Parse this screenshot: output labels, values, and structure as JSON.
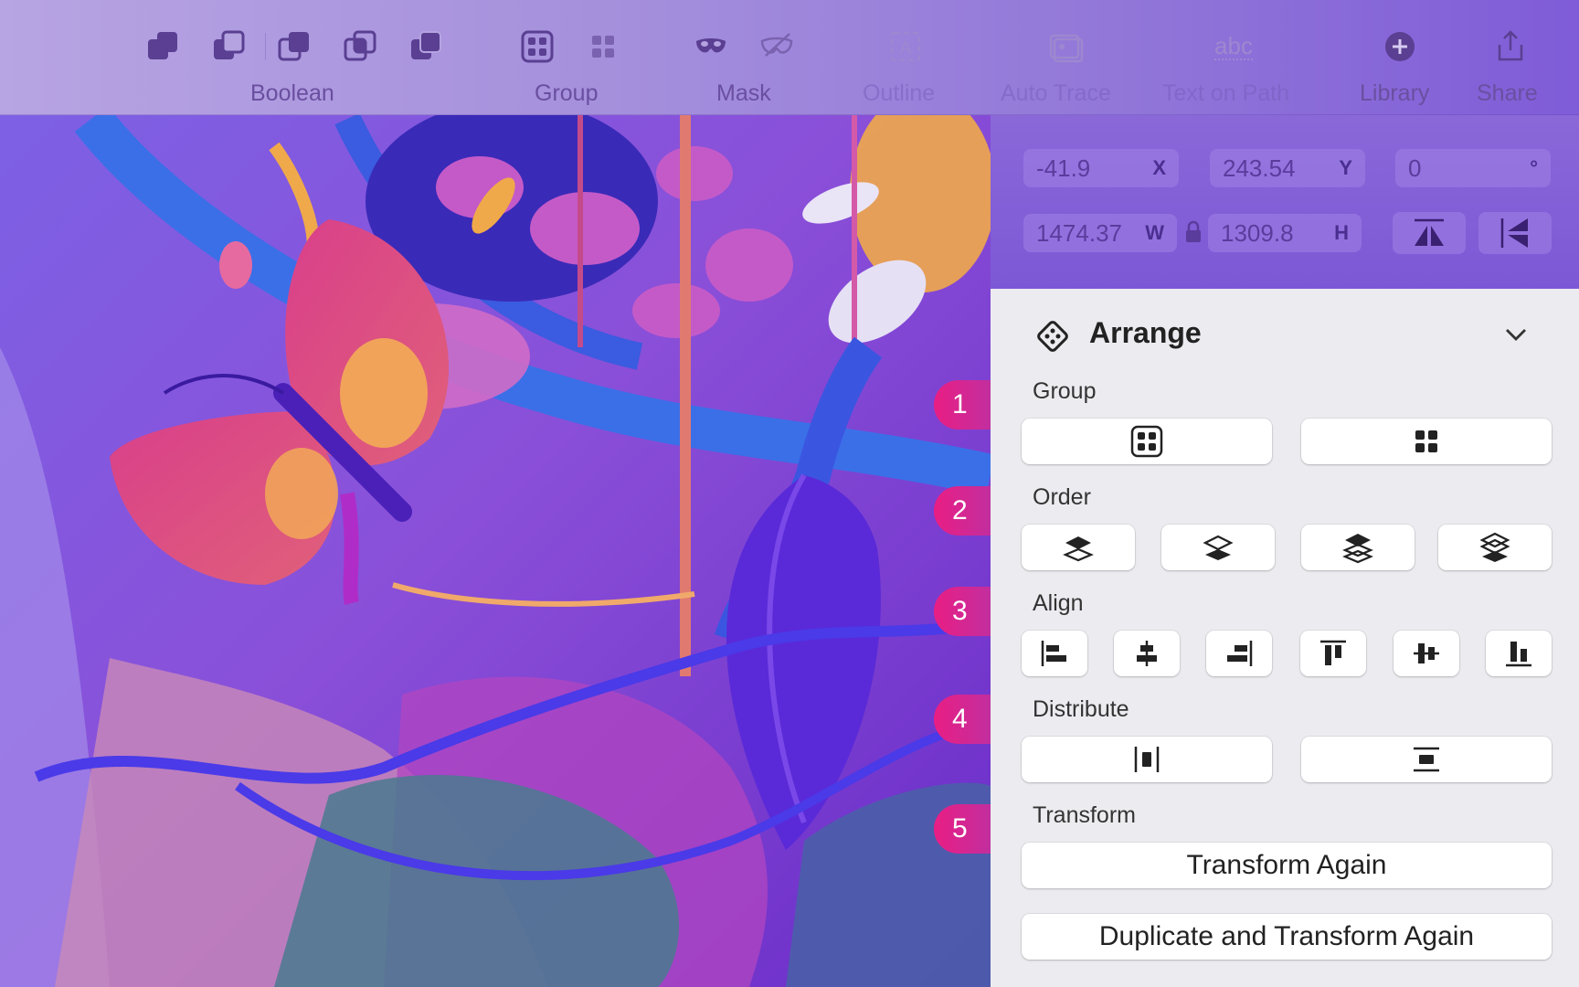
{
  "toolbar": {
    "boolean_label": "Boolean",
    "group_label": "Group",
    "mask_label": "Mask",
    "outline_label": "Outline",
    "auto_trace_label": "Auto Trace",
    "text_on_path_label": "Text on Path",
    "text_on_path_glyph": "abc",
    "library_label": "Library",
    "share_label": "Share"
  },
  "geometry": {
    "x_value": "-41.9",
    "x_unit": "X",
    "y_value": "243.54",
    "y_unit": "Y",
    "rotation_value": "0",
    "rotation_unit": "°",
    "w_value": "1474.37",
    "w_unit": "W",
    "h_value": "1309.8",
    "h_unit": "H"
  },
  "panel": {
    "title": "Arrange",
    "sections": {
      "group": "Group",
      "order": "Order",
      "align": "Align",
      "distribute": "Distribute",
      "transform": "Transform"
    },
    "transform_again_label": "Transform Again",
    "duplicate_transform_label": "Duplicate and Transform Again"
  },
  "callouts": [
    "1",
    "2",
    "3",
    "4",
    "5"
  ],
  "colors": {
    "accent_magenta": "#e91e84",
    "toolbar_purple": "#a48fdc",
    "panel_bg": "#ecebf0"
  }
}
